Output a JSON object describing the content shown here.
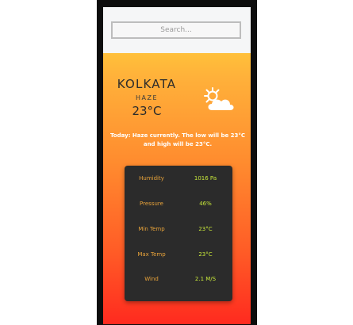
{
  "search": {
    "placeholder": "Search..."
  },
  "weather": {
    "city": "KOLKATA",
    "condition": "HAZE",
    "temperature": "23°C",
    "icon": "partly-cloudy-sun-icon",
    "summary": "Today: Haze currently. The low will be 23°C and high will be 23°C."
  },
  "stats": [
    {
      "label": "Humidity",
      "value": "1016 Pa"
    },
    {
      "label": "Pressure",
      "value": "46%"
    },
    {
      "label": "Min Temp",
      "value": "23°C"
    },
    {
      "label": "Max Temp",
      "value": "23°C"
    },
    {
      "label": "Wind",
      "value": "2.1 M/S"
    }
  ],
  "colors": {
    "gradient_top": "#ffde3c",
    "gradient_bottom": "#ff2a1f",
    "card_background": "#2b2b2b",
    "stat_label": "#e8a33a",
    "stat_value": "#c6e63a"
  }
}
